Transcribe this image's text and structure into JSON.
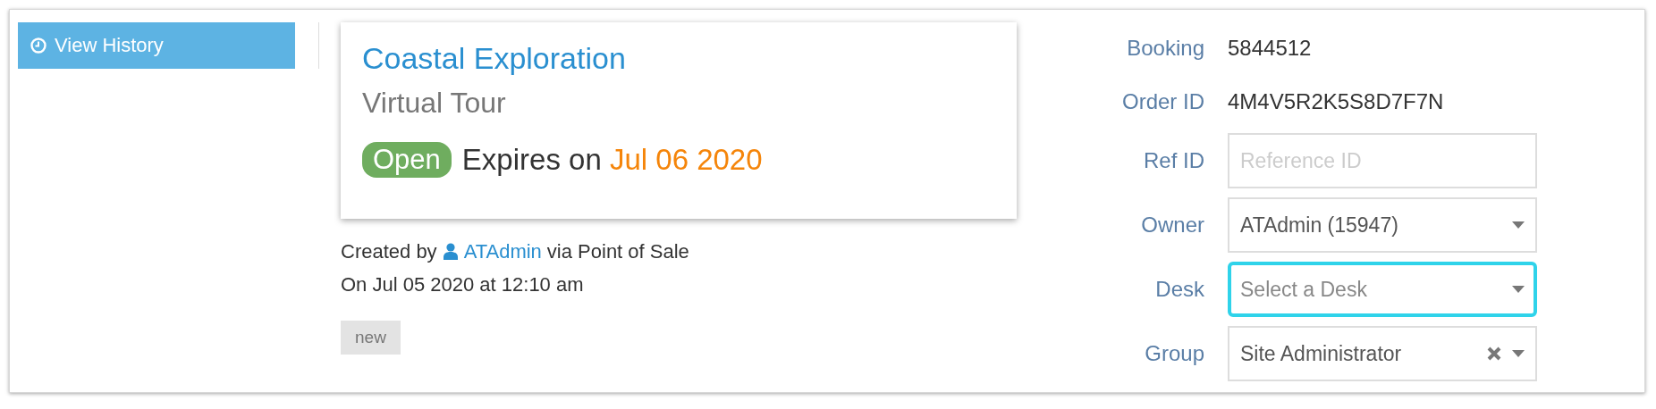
{
  "history_button": {
    "label": "View History"
  },
  "booking_card": {
    "title": "Coastal Exploration",
    "subtitle": "Virtual Tour",
    "status": "Open",
    "expires_label": "Expires on",
    "expires_date": "Jul 06 2020"
  },
  "created": {
    "prefix": "Created by",
    "user": "ATAdmin",
    "suffix": "via Point of Sale",
    "date_line": "On Jul 05 2020 at 12:10 am"
  },
  "tags": [
    "new"
  ],
  "details": [
    {
      "kind": "static",
      "label": "Booking",
      "value": "5844512"
    },
    {
      "kind": "static",
      "label": "Order ID",
      "value": "4M4V5R2K5S8D7F7N"
    },
    {
      "kind": "input",
      "label": "Ref ID",
      "placeholder": "Reference ID",
      "focused": false
    },
    {
      "kind": "select",
      "label": "Owner",
      "value": "ATAdmin (15947)",
      "focused": false,
      "clearable": false
    },
    {
      "kind": "select",
      "label": "Desk",
      "placeholder": "Select a Desk",
      "focused": true,
      "clearable": false
    },
    {
      "kind": "select",
      "label": "Group",
      "value": "Site Administrator",
      "focused": false,
      "clearable": true
    }
  ]
}
